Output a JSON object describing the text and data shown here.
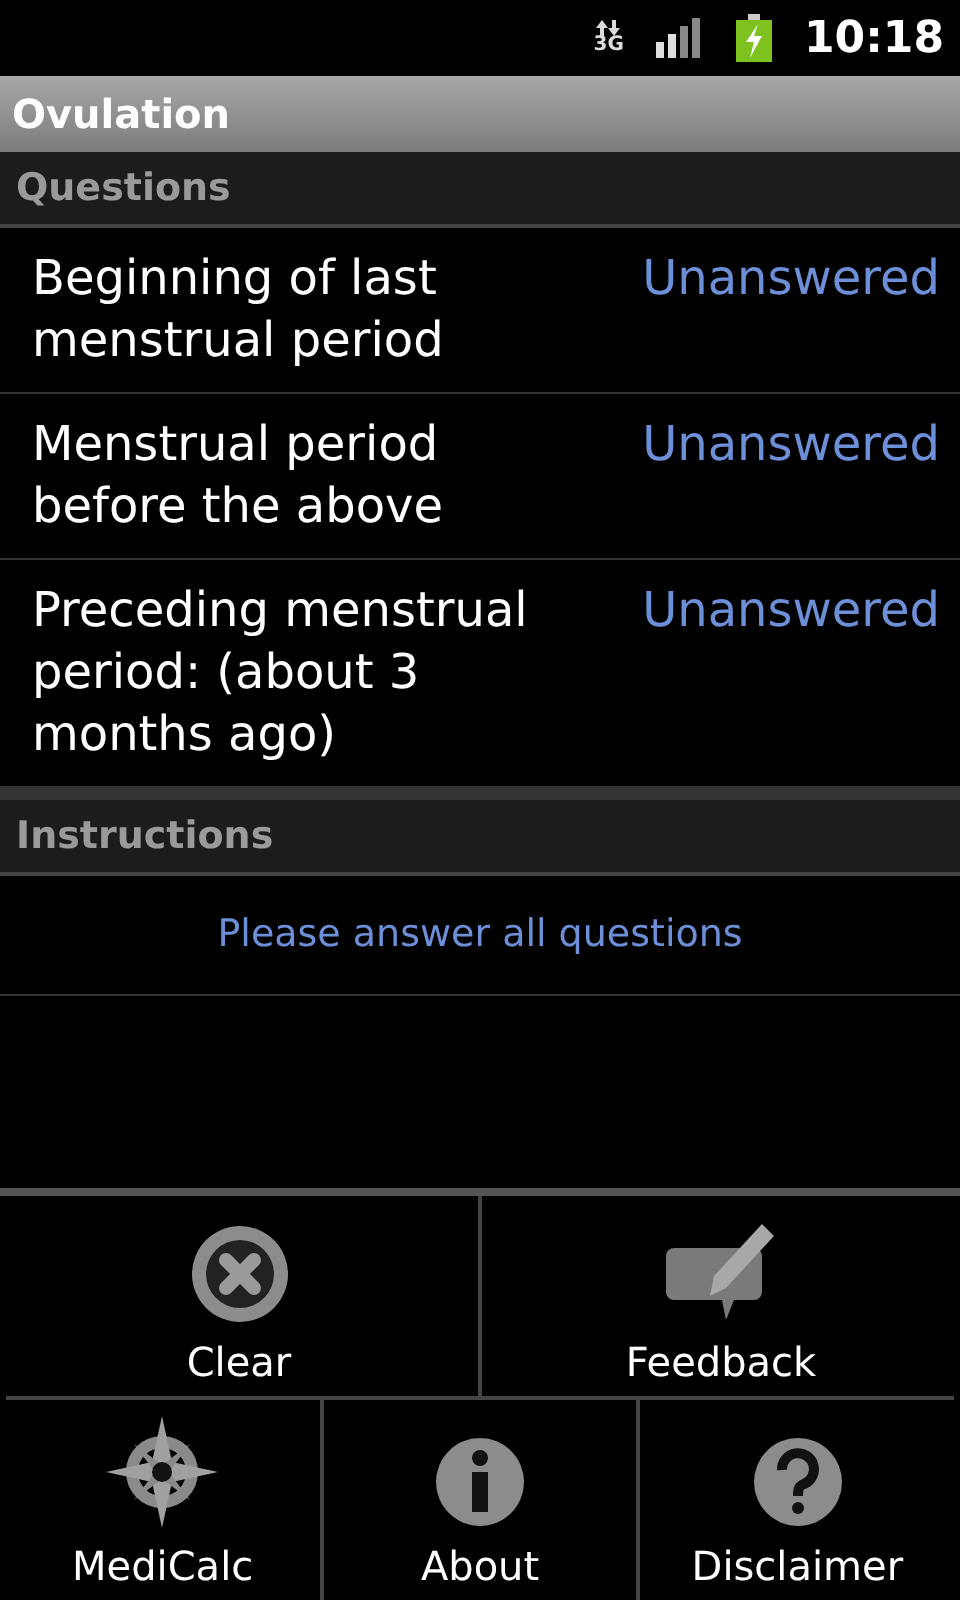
{
  "status_bar": {
    "network": "3G",
    "time": "10:18"
  },
  "title": "Ovulation",
  "questions": {
    "header": "Questions",
    "rows": [
      {
        "label": "Beginning of last menstrual period",
        "value": "Unanswered"
      },
      {
        "label": "Menstrual period before the above",
        "value": "Unanswered"
      },
      {
        "label": "Preceding menstrual period: (about 3 months ago)",
        "value": "Unanswered"
      }
    ]
  },
  "instructions": {
    "header": "Instructions",
    "text": "Please answer all questions"
  },
  "menu": [
    [
      {
        "label": "Clear",
        "kind": "clear"
      },
      {
        "label": "Feedback",
        "kind": "feedback"
      }
    ],
    [
      {
        "label": "MediCalc",
        "kind": "compass"
      },
      {
        "label": "About",
        "kind": "info"
      },
      {
        "label": "Disclaimer",
        "kind": "help"
      }
    ]
  ]
}
